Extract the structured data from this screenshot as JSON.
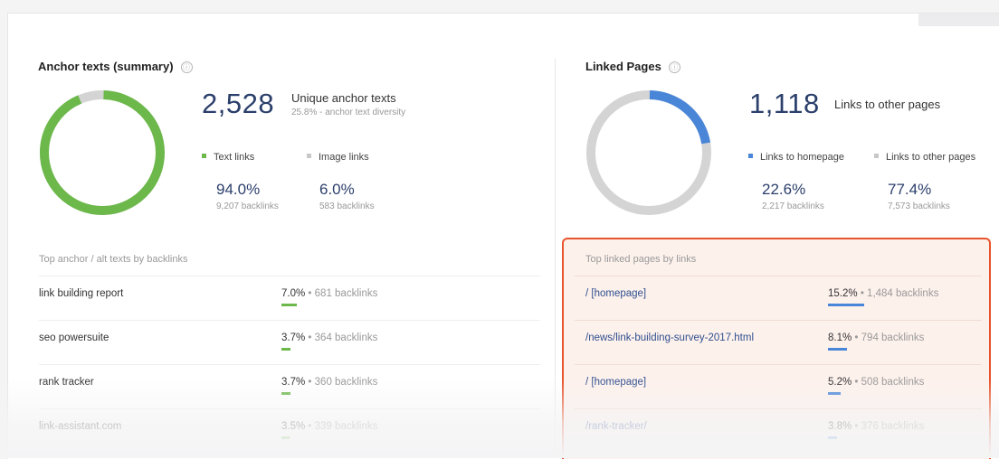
{
  "anchor": {
    "title": "Anchor texts (summary)",
    "info_icon": "ⓘ",
    "big_number": "2,528",
    "big_label": "Unique anchor texts",
    "sub_label": "25.8% - anchor text diversity",
    "donut_fractions": {
      "text_links": 0.94,
      "image_links": 0.06
    },
    "colors": {
      "primary": "#6cb84a",
      "secondary": "#d4d4d4"
    },
    "legend": [
      {
        "label": "Text links",
        "color": "#6cb84a",
        "pct": "94.0%",
        "count": "9,207 backlinks"
      },
      {
        "label": "Image links",
        "color": "#c8c8c8",
        "pct": "6.0%",
        "count": "583 backlinks"
      }
    ],
    "table_heading": "Top anchor / alt texts by backlinks",
    "rows": [
      {
        "text": "link building report",
        "pct": "7.0%",
        "backlinks": "681 backlinks",
        "share": 0.07
      },
      {
        "text": "seo powersuite",
        "pct": "3.7%",
        "backlinks": "364 backlinks",
        "share": 0.037
      },
      {
        "text": "rank tracker",
        "pct": "3.7%",
        "backlinks": "360 backlinks",
        "share": 0.037
      },
      {
        "text": "link-assistant.com",
        "pct": "3.5%",
        "backlinks": "339 backlinks",
        "share": 0.035
      }
    ]
  },
  "linked": {
    "title": "Linked Pages",
    "info_icon": "ⓘ",
    "big_number": "1,118",
    "big_label": "Links to other pages",
    "donut_fractions": {
      "homepage": 0.226,
      "other_pages": 0.774
    },
    "colors": {
      "primary": "#4a86d8",
      "secondary": "#d4d4d4",
      "highlight": "#e8542c"
    },
    "legend": [
      {
        "label": "Links to homepage",
        "color": "#4a86d8",
        "pct": "22.6%",
        "count": "2,217 backlinks"
      },
      {
        "label": "Links to other pages",
        "color": "#c8c8c8",
        "pct": "77.4%",
        "count": "7,573 backlinks"
      }
    ],
    "table_heading": "Top linked pages by links",
    "rows": [
      {
        "text": "/ [homepage]",
        "pct": "15.2%",
        "backlinks": "1,484 backlinks",
        "share": 0.152
      },
      {
        "text": "/news/link-building-survey-2017.html",
        "pct": "8.1%",
        "backlinks": "794 backlinks",
        "share": 0.081
      },
      {
        "text": "/ [homepage]",
        "pct": "5.2%",
        "backlinks": "508 backlinks",
        "share": 0.052
      },
      {
        "text": "/rank-tracker/",
        "pct": "3.8%",
        "backlinks": "376 backlinks",
        "share": 0.038
      }
    ]
  },
  "separator": "•"
}
